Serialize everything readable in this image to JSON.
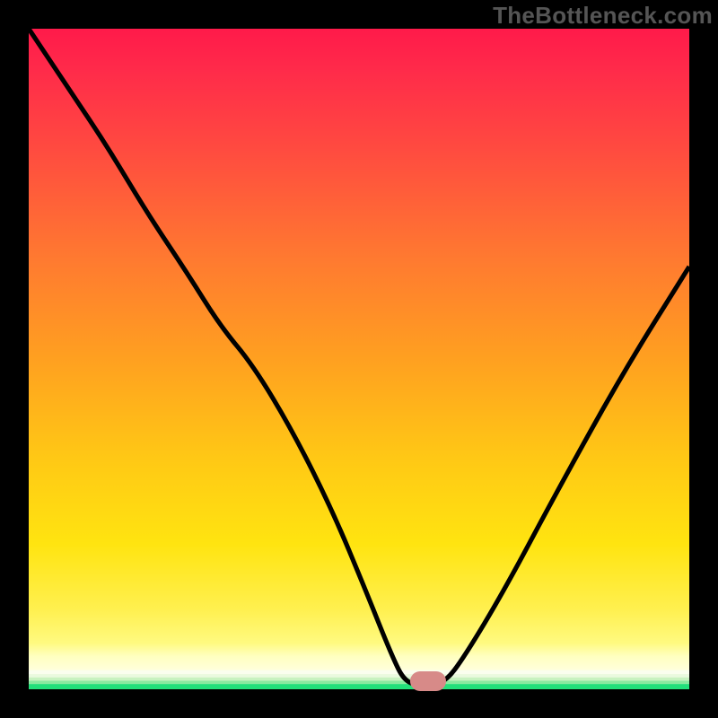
{
  "watermark": {
    "text": "TheBottleneck.com"
  },
  "chart_data": {
    "type": "line",
    "title": "",
    "xlabel": "",
    "ylabel": "",
    "xlim": [
      0,
      100
    ],
    "ylim": [
      0,
      100
    ],
    "grid": false,
    "legend": false,
    "comment": "x is position along width (0-100), y is bottleneck percentage (0 at bottom, 100 at top). Curve falls from top-left, reaches a flat minimum ≈0 around x=57-63, then rises toward the right.",
    "series": [
      {
        "name": "bottleneck-curve",
        "x": [
          0,
          6,
          12,
          18,
          24,
          29,
          34,
          40,
          46,
          51,
          55,
          57,
          60,
          63,
          66,
          72,
          80,
          90,
          100
        ],
        "values": [
          100,
          91,
          82,
          72,
          63,
          55,
          49,
          39,
          27,
          15,
          5,
          1,
          0.5,
          1,
          5,
          15,
          30,
          48,
          64
        ]
      }
    ],
    "marker": {
      "x_percent": 60.5,
      "y_percent_from_bottom": 1.2,
      "description": "configuration marker"
    },
    "ground_bands": [
      {
        "color": "#22e07a",
        "y_top_from_bottom": 1.0
      },
      {
        "color": "#8aeaa0",
        "y_top_from_bottom": 1.45
      },
      {
        "color": "#c8f2c0",
        "y_top_from_bottom": 1.9
      },
      {
        "color": "#eafadf",
        "y_top_from_bottom": 2.35
      },
      {
        "color": "#fafeee",
        "y_top_from_bottom": 2.85
      }
    ],
    "gradient_stops": [
      {
        "pos": 0,
        "color": "#ff1a4a"
      },
      {
        "pos": 18,
        "color": "#ff4a40"
      },
      {
        "pos": 35,
        "color": "#ff7a30"
      },
      {
        "pos": 50,
        "color": "#ffa020"
      },
      {
        "pos": 65,
        "color": "#ffc815"
      },
      {
        "pos": 78,
        "color": "#ffe410"
      },
      {
        "pos": 93,
        "color": "#fffa80"
      },
      {
        "pos": 100,
        "color": "#fffff5"
      }
    ],
    "colors": {
      "curve": "#000000",
      "frame": "#000000",
      "marker": "#d78a88",
      "watermark": "#555555"
    }
  }
}
